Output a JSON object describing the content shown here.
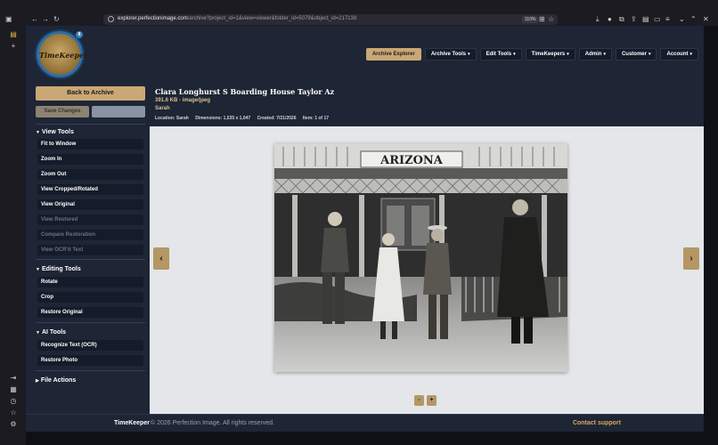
{
  "browser": {
    "url_host": "explorer.perfectionimage.com",
    "url_path": "/archive?project_id=1&view=viewer&folder_id=5079&object_id=217139",
    "zoom": "110%",
    "back_icon": "arrow-left-icon",
    "forward_icon": "arrow-right-icon",
    "reload_icon": "reload-icon"
  },
  "app": {
    "logo_text": "TimeKeeper",
    "logo_badge": "8",
    "nav": [
      {
        "label": "Archive Explorer",
        "active": true
      },
      {
        "label": "Archive Tools",
        "caret": "▾"
      },
      {
        "label": "Edit Tools",
        "caret": "▾"
      },
      {
        "label": "TimeKeepers",
        "caret": "▾"
      },
      {
        "label": "Admin",
        "caret": "▾"
      },
      {
        "label": "Customer",
        "caret": "▾"
      },
      {
        "label": "Account",
        "caret": "▾"
      }
    ]
  },
  "sidebar": {
    "back_label": "Back to Archive",
    "save_label": "Save Changes",
    "view_tools": {
      "title": "View Tools",
      "items": [
        {
          "label": "Fit to Window",
          "enabled": true
        },
        {
          "label": "Zoom In",
          "enabled": true
        },
        {
          "label": "Zoom Out",
          "enabled": true
        },
        {
          "label": "View Cropped/Rotated",
          "enabled": true
        },
        {
          "label": "View Original",
          "enabled": true
        },
        {
          "label": "View Restored",
          "enabled": false
        },
        {
          "label": "Compare Restoration",
          "enabled": false
        },
        {
          "label": "View OCR'd Text",
          "enabled": false
        }
      ]
    },
    "editing_tools": {
      "title": "Editing Tools",
      "items": [
        {
          "label": "Rotate",
          "enabled": true
        },
        {
          "label": "Crop",
          "enabled": true
        },
        {
          "label": "Restore Original",
          "enabled": true
        }
      ]
    },
    "ai_tools": {
      "title": "AI Tools",
      "items": [
        {
          "label": "Recognize Text (OCR)",
          "enabled": true
        },
        {
          "label": "Restore Photo",
          "enabled": true
        }
      ]
    },
    "file_actions": {
      "title": "File Actions"
    }
  },
  "document": {
    "title": "Clara Longhurst S Boarding House Taylor Az",
    "size_type": "391.6 KB - image/jpeg",
    "owner": "Sarah",
    "location": "Location: Sarah",
    "dimensions": "Dimensions: 1,535 x 1,047",
    "created": "Created: 7/21/2026",
    "item": "Item: 1 of 17",
    "sign_text": "ARIZONA"
  },
  "viewer": {
    "prev": "‹",
    "next": "›",
    "zoom_out": "-",
    "zoom_in": "+"
  },
  "footer": {
    "brand": "TimeKeeper",
    "copyright": "© 2026 Perfection Image. All rights reserved.",
    "support": "Contact support"
  },
  "colors": {
    "accent": "#c9a875",
    "panel": "#1e2535",
    "button": "#141b29",
    "viewer_bg": "#e4e6ea",
    "link": "#d8a860"
  }
}
